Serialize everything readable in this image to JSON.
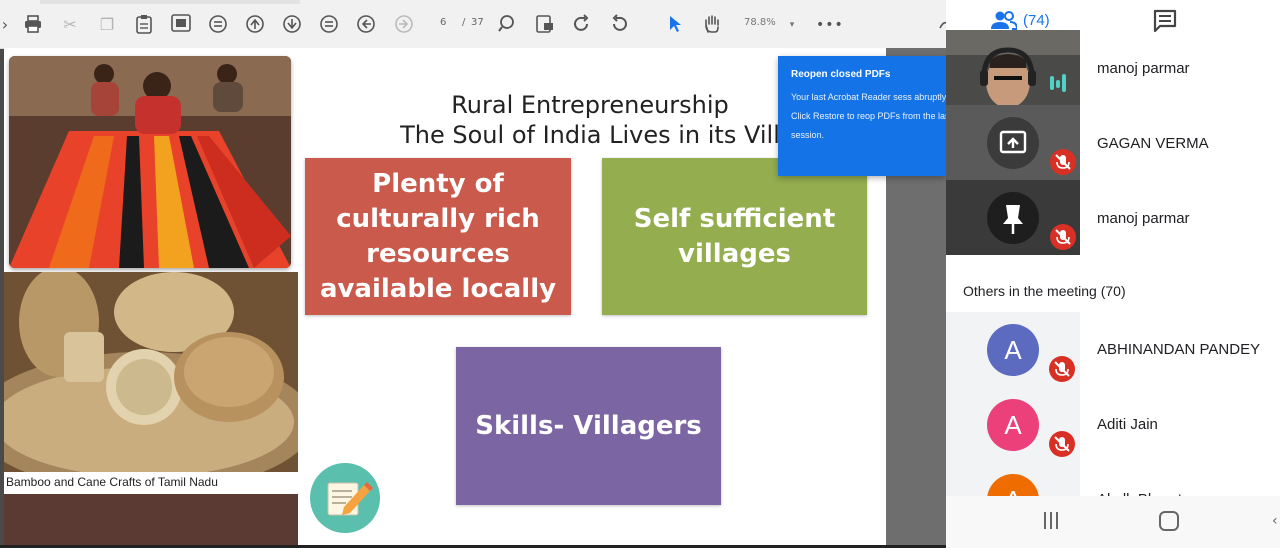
{
  "toolbar": {
    "page_current": "6",
    "page_separator": "/",
    "page_total": "37",
    "zoom": "78.8%"
  },
  "slide": {
    "title_line1": "Rural Entrepreneurship",
    "title_line2": "The Soul of India Lives in its Vill",
    "box1_lines": [
      "Plenty of",
      "culturally rich",
      "resources",
      "available locally"
    ],
    "box2_lines": [
      "Self sufficient",
      "villages"
    ],
    "box3_text": "Skills- Villagers",
    "image_caption": "Bamboo and Cane Crafts of Tamil Nadu",
    "colors": {
      "box1": "#c95a4c",
      "box2": "#93ad4f",
      "box3": "#7b66a3"
    }
  },
  "popup": {
    "title": "Reopen closed PDFs",
    "body": "Your last Acrobat Reader sess abruptly. Click Restore to reop PDFs from the last session."
  },
  "panel": {
    "people_count": "(74)",
    "tiles": [
      {
        "name": "manoj parmar",
        "type": "video"
      },
      {
        "name": "GAGAN VERMA",
        "type": "screen-share"
      },
      {
        "name": "manoj parmar",
        "type": "pin"
      }
    ],
    "others_label": "Others in the meeting (70)",
    "others": [
      {
        "initial": "A",
        "name": "ABHINANDAN PANDEY",
        "color": "#5c6bc0"
      },
      {
        "initial": "A",
        "name": "Aditi Jain",
        "color": "#ec407a"
      },
      {
        "initial": "A",
        "name": "Akalk Bharat",
        "color": "#ef6c00"
      }
    ],
    "accent_color": "#1a73e8"
  }
}
